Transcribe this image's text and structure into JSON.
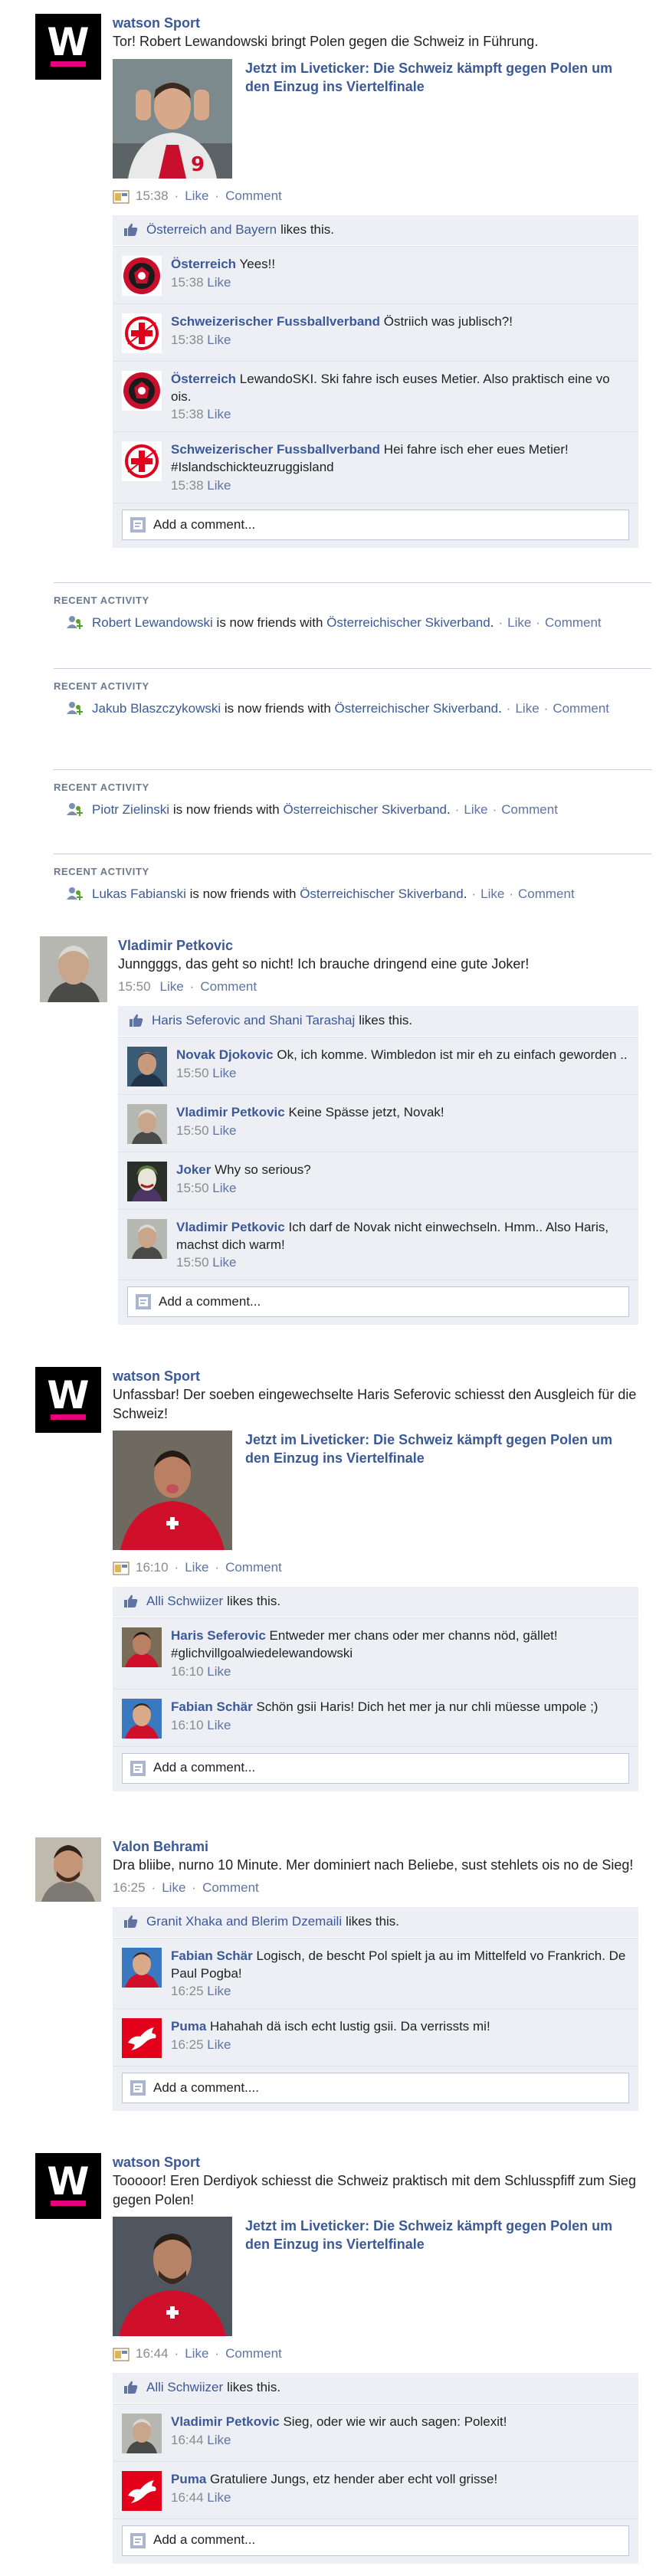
{
  "ui": {
    "like": "Like",
    "comment": "Comment",
    "recent_activity": "Recent Activity",
    "likes_this": "likes this.",
    "add_comment": "Add a comment...",
    "add_comment_alt": "Add a comment....",
    "friends_with": "is now friends with"
  },
  "posts": [
    {
      "author": "watson Sport",
      "text": "Tor! Robert Lewandowski bringt Polen gegen die Schweiz in Führung.",
      "link_title": "Jetzt im Liveticker: Die Schweiz kämpft gegen Polen um den Einzug ins Viertelfinale",
      "time": "15:38",
      "likes": "Österreich and Bayern",
      "comments": [
        {
          "name": "Österreich",
          "text": "Yees!!",
          "time": "15:38"
        },
        {
          "name": "Schweizerischer Fussballverband",
          "text": "Östriich was jublisch?!",
          "time": "15:38"
        },
        {
          "name": "Österreich",
          "text": "LewandoSKI. Ski fahre isch euses Metier. Also praktisch eine vo ois.",
          "time": "15:38"
        },
        {
          "name": "Schweizerischer Fussballverband",
          "text": "Hei fahre isch eher eues Metier! #Islandschickteuzruggisland",
          "time": "15:38"
        }
      ]
    },
    {
      "author": "Vladimir Petkovic",
      "text": "Junngggs, das geht so nicht! Ich brauche dringend eine gute Joker!",
      "time": "15:50",
      "likes": "Haris Seferovic and Shani Tarashaj",
      "comments": [
        {
          "name": "Novak Djokovic",
          "text": "Ok, ich komme. Wimbledon ist mir eh zu einfach geworden ..",
          "time": "15:50"
        },
        {
          "name": "Vladimir Petkovic",
          "text": "Keine Spässe jetzt, Novak!",
          "time": "15:50"
        },
        {
          "name": "Joker",
          "text": "Why so serious?",
          "time": "15:50"
        },
        {
          "name": "Vladimir Petkovic",
          "text": "Ich darf de Novak nicht einwechseln. Hmm.. Also Haris, machst dich warm!",
          "time": "15:50"
        }
      ]
    },
    {
      "author": "watson Sport",
      "text": "Unfassbar! Der soeben eingewechselte Haris Seferovic schiesst den Ausgleich für die Schweiz!",
      "link_title": "Jetzt im Liveticker: Die Schweiz kämpft gegen Polen um den Einzug ins Viertelfinale",
      "time": "16:10",
      "likes": "Alli Schwiizer",
      "comments": [
        {
          "name": "Haris Seferovic",
          "text": "Entweder mer chans oder mer channs nöd, gället! #glichvillgoalwiedelewandowski",
          "time": "16:10"
        },
        {
          "name": "Fabian Schär",
          "text": "Schön gsii Haris! Dich het mer ja nur chli müesse umpole ;)",
          "time": "16:10"
        }
      ]
    },
    {
      "author": "Valon Behrami",
      "text": "Dra bliibe, nurno 10 Minute. Mer dominiert nach Beliebe, sust stehlets ois no de Sieg!",
      "time": "16:25",
      "likes": "Granit Xhaka and Blerim Dzemaili",
      "comments": [
        {
          "name": "Fabian Schär",
          "text": "Logisch, de bescht Pol spielt ja au im Mittelfeld vo Frankrich. De Paul Pogba!",
          "time": "16:25"
        },
        {
          "name": "Puma",
          "text": "Hahahah dä isch echt lustig gsii. Da verrissts mi!",
          "time": "16:25"
        }
      ]
    },
    {
      "author": "watson Sport",
      "text": "Tooooor! Eren Derdiyok schiesst die Schweiz praktisch mit dem Schlusspfiff zum Sieg gegen Polen!",
      "link_title": "Jetzt im Liveticker: Die Schweiz kämpft gegen Polen um den Einzug ins Viertelfinale",
      "time": "16:44",
      "likes": "Alli Schwiizer",
      "comments": [
        {
          "name": "Vladimir Petkovic",
          "text": "Sieg, oder wie wir auch sagen: Polexit!",
          "time": "16:44"
        },
        {
          "name": "Puma",
          "text": "Gratuliere Jungs, etz hender aber echt voll grisse!",
          "time": "16:44"
        }
      ]
    }
  ],
  "activities": [
    {
      "person": "Robert Lewandowski",
      "page": "Österreichischer Skiverband"
    },
    {
      "person": "Jakub Blaszczykowski",
      "page": "Österreichischer Skiverband"
    },
    {
      "person": "Piotr Zielinski",
      "page": "Österreichischer Skiverband"
    },
    {
      "person": "Lukas Fabianski",
      "page": "Österreichischer Skiverband"
    }
  ],
  "colors": {
    "facebook_blue": "#3b5998",
    "watson_pink": "#e6007e",
    "comment_bg": "#edeff4"
  }
}
